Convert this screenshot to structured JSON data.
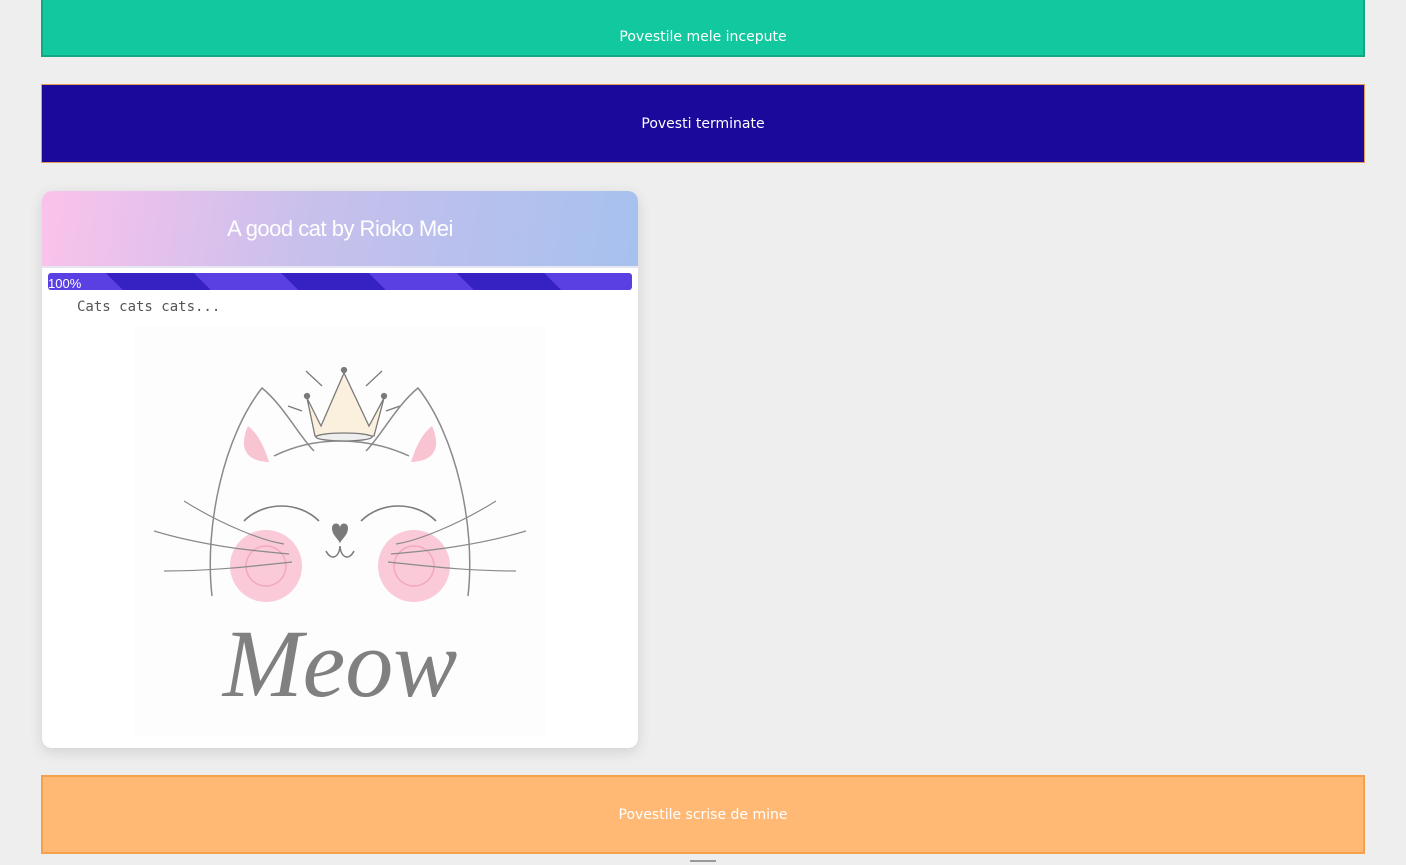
{
  "sections": {
    "started_label": "Povestile mele incepute",
    "finished_label": "Povesti terminate",
    "mine_label": "Povestile scrise de mine"
  },
  "story_card": {
    "title": "A good cat by Rioko Mei",
    "progress": 100,
    "progress_label": "100%",
    "description": "Cats cats cats...",
    "image_text": "Meow"
  },
  "colors": {
    "started": "#12c89e",
    "finished": "#1b099c",
    "mine": "#ffb975",
    "progress": "#5a40e2"
  }
}
